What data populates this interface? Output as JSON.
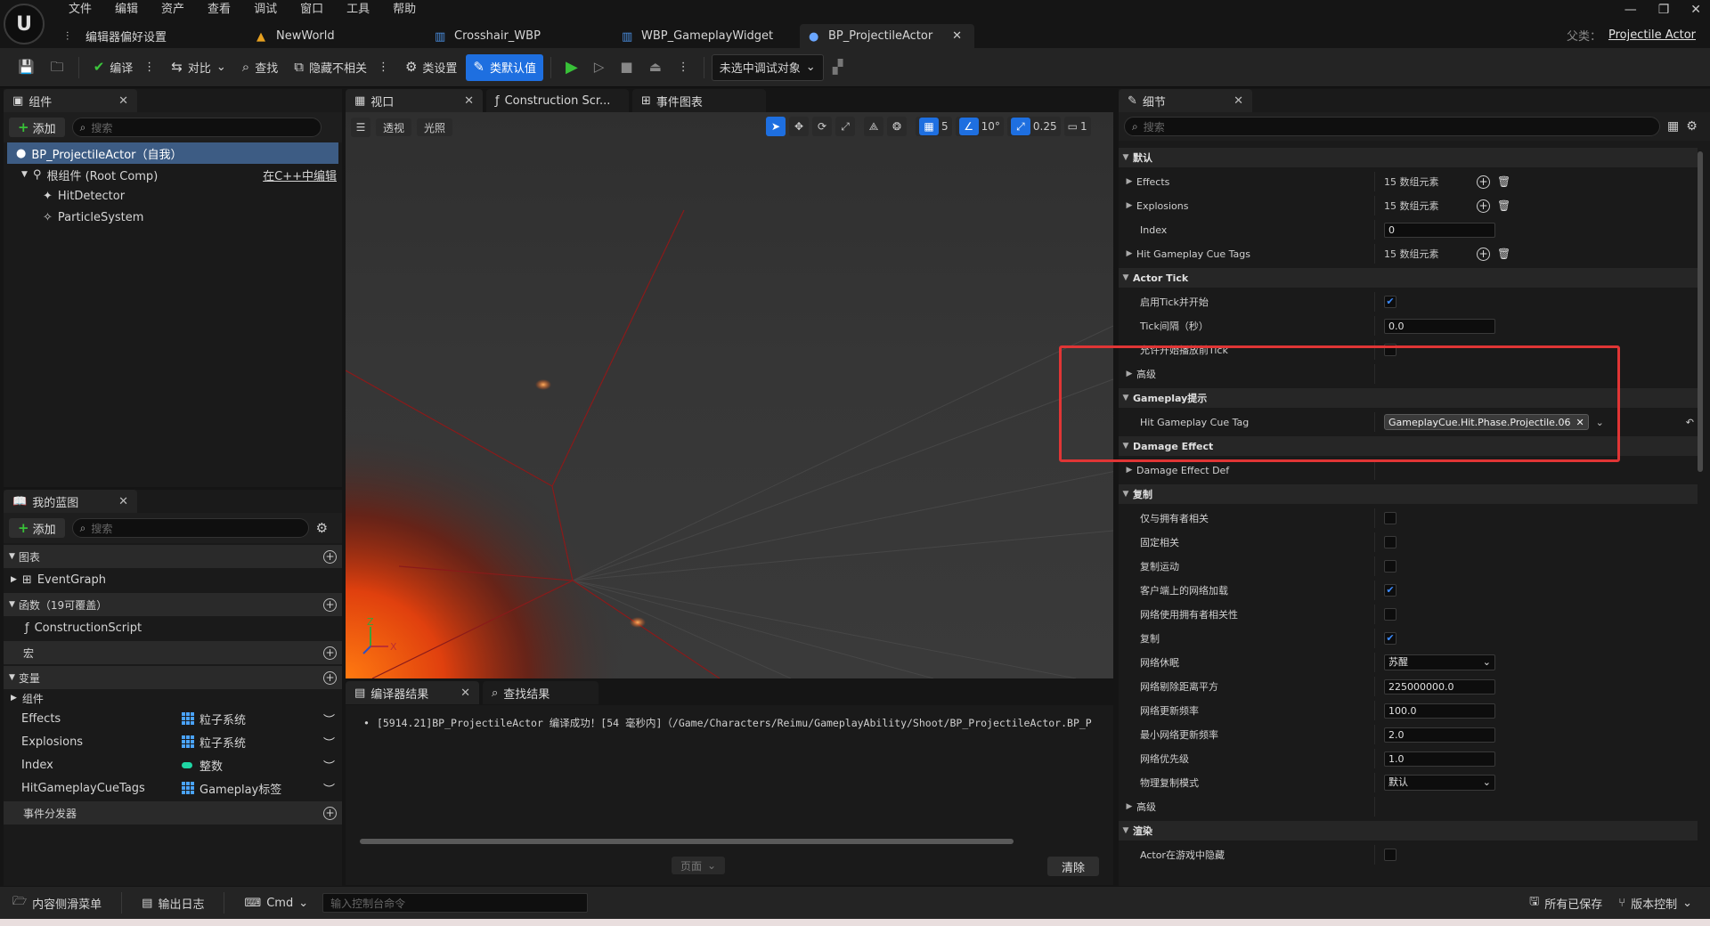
{
  "menu": [
    "文件",
    "编辑",
    "资产",
    "查看",
    "调试",
    "窗口",
    "工具",
    "帮助"
  ],
  "tabs": [
    {
      "label": "编辑器偏好设置"
    },
    {
      "label": "NewWorld"
    },
    {
      "label": "Crosshair_WBP"
    },
    {
      "label": "WBP_GameplayWidget"
    },
    {
      "label": "BP_ProjectileActor"
    }
  ],
  "parent_class": {
    "label": "父类：",
    "value": "Projectile Actor"
  },
  "toolbar": {
    "compile": "编译",
    "diff": "对比",
    "find": "查找",
    "hide_unrelated": "隐藏不相关",
    "class_settings": "类设置",
    "class_defaults": "类默认值",
    "debug_target": "未选中调试对象"
  },
  "components": {
    "tab": "组件",
    "add": "添加",
    "search_placeholder": "搜索",
    "self": "BP_ProjectileActor（自我）",
    "root": "根组件 (Root Comp)",
    "edit_cpp": "在C++中编辑",
    "children": [
      "HitDetector",
      "ParticleSystem"
    ]
  },
  "myblueprint": {
    "tab": "我的蓝图",
    "add": "添加",
    "search_placeholder": "搜索",
    "graphs": "图表",
    "eventgraph": "EventGraph",
    "functions": "函数（19可覆盖）",
    "construction": "ConstructionScript",
    "macros": "宏",
    "variables": "变量",
    "components": "组件",
    "vars": [
      {
        "name": "Effects",
        "type": "粒子系统"
      },
      {
        "name": "Explosions",
        "type": "粒子系统"
      },
      {
        "name": "Index",
        "type": "整数"
      },
      {
        "name": "HitGameplayCueTags",
        "type": "Gameplay标签"
      }
    ],
    "dispatchers": "事件分发器"
  },
  "viewport": {
    "tabs": [
      "视口",
      "Construction Scr...",
      "事件图表"
    ],
    "perspective": "透视",
    "lit": "光照",
    "grid": "5",
    "angle": "10°",
    "scale": "0.25",
    "camera": "1"
  },
  "compiler": {
    "tabs": [
      "编译器结果",
      "查找结果"
    ],
    "message": "[5914.21]BP_ProjectileActor 编译成功！[54 毫秒内]（/Game/Characters/Reimu/GameplayAbility/Shoot/BP_ProjectileActor.BP_P",
    "page": "页面",
    "clear": "清除"
  },
  "details": {
    "tab": "细节",
    "search_placeholder": "搜索",
    "rows": [
      {
        "kind": "sec",
        "label": "默认"
      },
      {
        "kind": "arr",
        "label": "Effects",
        "value": "15 数组元素"
      },
      {
        "kind": "arr",
        "label": "Explosions",
        "value": "15 数组元素"
      },
      {
        "kind": "txt",
        "label": "Index",
        "value": "0"
      },
      {
        "kind": "arr",
        "label": "Hit Gameplay Cue Tags",
        "value": "15 数组元素"
      },
      {
        "kind": "sec",
        "label": "Actor Tick"
      },
      {
        "kind": "chk",
        "label": "启用Tick并开始",
        "checked": true
      },
      {
        "kind": "txt",
        "label": "Tick间隔（秒）",
        "value": "0.0"
      },
      {
        "kind": "chk",
        "label": "允许开始播放前Tick",
        "checked": false
      },
      {
        "kind": "sub",
        "label": "高级"
      },
      {
        "kind": "sec",
        "label": "Gameplay提示"
      },
      {
        "kind": "tag",
        "label": "Hit Gameplay Cue Tag",
        "value": "GameplayCue.Hit.Phase.Projectile.06"
      },
      {
        "kind": "sec",
        "label": "Damage Effect"
      },
      {
        "kind": "sub",
        "label": "Damage Effect Def"
      },
      {
        "kind": "sec",
        "label": "复制"
      },
      {
        "kind": "chk",
        "label": "仅与拥有者相关",
        "checked": false
      },
      {
        "kind": "chk",
        "label": "固定相关",
        "checked": false
      },
      {
        "kind": "chk",
        "label": "复制运动",
        "checked": false
      },
      {
        "kind": "chk",
        "label": "客户端上的网络加载",
        "checked": true
      },
      {
        "kind": "chk",
        "label": "网络使用拥有者相关性",
        "checked": false
      },
      {
        "kind": "chk",
        "label": "复制",
        "checked": true
      },
      {
        "kind": "dd",
        "label": "网络休眠",
        "value": "苏醒"
      },
      {
        "kind": "txt",
        "label": "网络剔除距离平方",
        "value": "225000000.0"
      },
      {
        "kind": "txt",
        "label": "网络更新频率",
        "value": "100.0"
      },
      {
        "kind": "txt",
        "label": "最小网络更新频率",
        "value": "2.0"
      },
      {
        "kind": "txt",
        "label": "网络优先级",
        "value": "1.0"
      },
      {
        "kind": "dd",
        "label": "物理复制模式",
        "value": "默认"
      },
      {
        "kind": "sub",
        "label": "高级"
      },
      {
        "kind": "sec",
        "label": "渲染"
      },
      {
        "kind": "chk",
        "label": "Actor在游戏中隐藏",
        "checked": false
      }
    ]
  },
  "statusbar": {
    "content_drawer": "内容侧滑菜单",
    "output_log": "输出日志",
    "cmd": "Cmd",
    "console_placeholder": "输入控制台命令",
    "saved": "所有已保存",
    "source_control": "版本控制"
  },
  "colors": {
    "accent": "#1e6fe0",
    "highlight_box": "#e03535",
    "selection": "#3d5c84"
  }
}
